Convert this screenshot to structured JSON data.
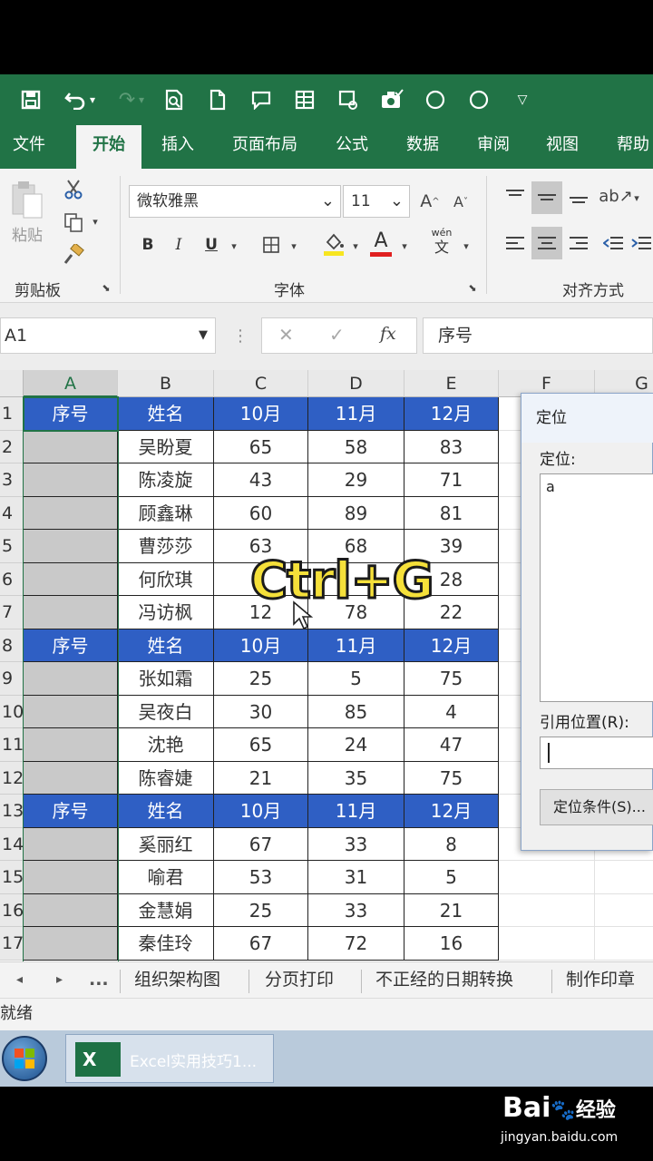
{
  "qat": {
    "icons": [
      "save-icon",
      "undo-icon",
      "redo-icon",
      "print-preview-icon",
      "new-doc-icon",
      "comment-icon",
      "form-icon",
      "camera-icon",
      "check-icon",
      "circle-icon",
      "circle-icon",
      "dropdown-icon"
    ]
  },
  "tabs": [
    "文件",
    "开始",
    "插入",
    "页面布局",
    "公式",
    "数据",
    "审阅",
    "视图",
    "帮助"
  ],
  "ribbon": {
    "paste_label": "粘贴",
    "clipboard_label": "剪贴板",
    "font_name": "微软雅黑",
    "font_size": "11",
    "bold": "B",
    "italic": "I",
    "underline": "U",
    "font_color_letter": "A",
    "font_group_label": "字体",
    "align_group_label": "对齐方式",
    "wen": "wén",
    "wen_char": "文",
    "grow_font": "A",
    "shrink_font": "A"
  },
  "formula_bar": {
    "name_box": "A1",
    "cancel": "✕",
    "enter": "✓",
    "fx": "fx",
    "content": "序号"
  },
  "columns": [
    "A",
    "B",
    "C",
    "D",
    "E",
    "F",
    "G"
  ],
  "rows": [
    {
      "n": "1",
      "type": "hdr",
      "a": "序号",
      "b": "姓名",
      "c": "10月",
      "d": "11月",
      "e": "12月"
    },
    {
      "n": "2",
      "type": "data",
      "a": "",
      "b": "吴盼夏",
      "c": "65",
      "d": "58",
      "e": "83"
    },
    {
      "n": "3",
      "type": "data",
      "a": "",
      "b": "陈凌旋",
      "c": "43",
      "d": "29",
      "e": "71"
    },
    {
      "n": "4",
      "type": "data",
      "a": "",
      "b": "顾鑫琳",
      "c": "60",
      "d": "89",
      "e": "81"
    },
    {
      "n": "5",
      "type": "data",
      "a": "",
      "b": "曹莎莎",
      "c": "63",
      "d": "68",
      "e": "39"
    },
    {
      "n": "6",
      "type": "data",
      "a": "",
      "b": "何欣琪",
      "c": "",
      "d": "",
      "e": "28"
    },
    {
      "n": "7",
      "type": "data",
      "a": "",
      "b": "冯访枫",
      "c": "12",
      "d": "78",
      "e": "22"
    },
    {
      "n": "8",
      "type": "hdr",
      "a": "序号",
      "b": "姓名",
      "c": "10月",
      "d": "11月",
      "e": "12月"
    },
    {
      "n": "9",
      "type": "data",
      "a": "",
      "b": "张如霜",
      "c": "25",
      "d": "5",
      "e": "75"
    },
    {
      "n": "10",
      "type": "data",
      "a": "",
      "b": "吴夜白",
      "c": "30",
      "d": "85",
      "e": "4"
    },
    {
      "n": "11",
      "type": "data",
      "a": "",
      "b": "沈艳",
      "c": "65",
      "d": "24",
      "e": "47"
    },
    {
      "n": "12",
      "type": "data",
      "a": "",
      "b": "陈睿婕",
      "c": "21",
      "d": "35",
      "e": "75"
    },
    {
      "n": "13",
      "type": "hdr",
      "a": "序号",
      "b": "姓名",
      "c": "10月",
      "d": "11月",
      "e": "12月"
    },
    {
      "n": "14",
      "type": "data",
      "a": "",
      "b": "奚丽红",
      "c": "67",
      "d": "33",
      "e": "8"
    },
    {
      "n": "15",
      "type": "data",
      "a": "",
      "b": "喻君",
      "c": "53",
      "d": "31",
      "e": "5"
    },
    {
      "n": "16",
      "type": "data",
      "a": "",
      "b": "金慧娟",
      "c": "25",
      "d": "33",
      "e": "21"
    },
    {
      "n": "17",
      "type": "data",
      "a": "",
      "b": "秦佳玲",
      "c": "67",
      "d": "72",
      "e": "16"
    }
  ],
  "dialog": {
    "title": "定位",
    "list_label": "定位:",
    "list_item": "a",
    "ref_label": "引用位置(R):",
    "special_button": "定位条件(S)..."
  },
  "overlay_text": "Ctrl+G",
  "sheet_tabs": [
    "组织架构图",
    "分页打印",
    "不正经的日期转换",
    "制作印章"
  ],
  "sheet_nav": {
    "prev": "◂",
    "next": "▸",
    "more": "..."
  },
  "status": "就绪",
  "taskbar": {
    "app": "Excel实用技巧1..."
  },
  "watermark": {
    "brand": "Bai",
    "brand2": "经验",
    "url": "jingyan.baidu.com"
  }
}
